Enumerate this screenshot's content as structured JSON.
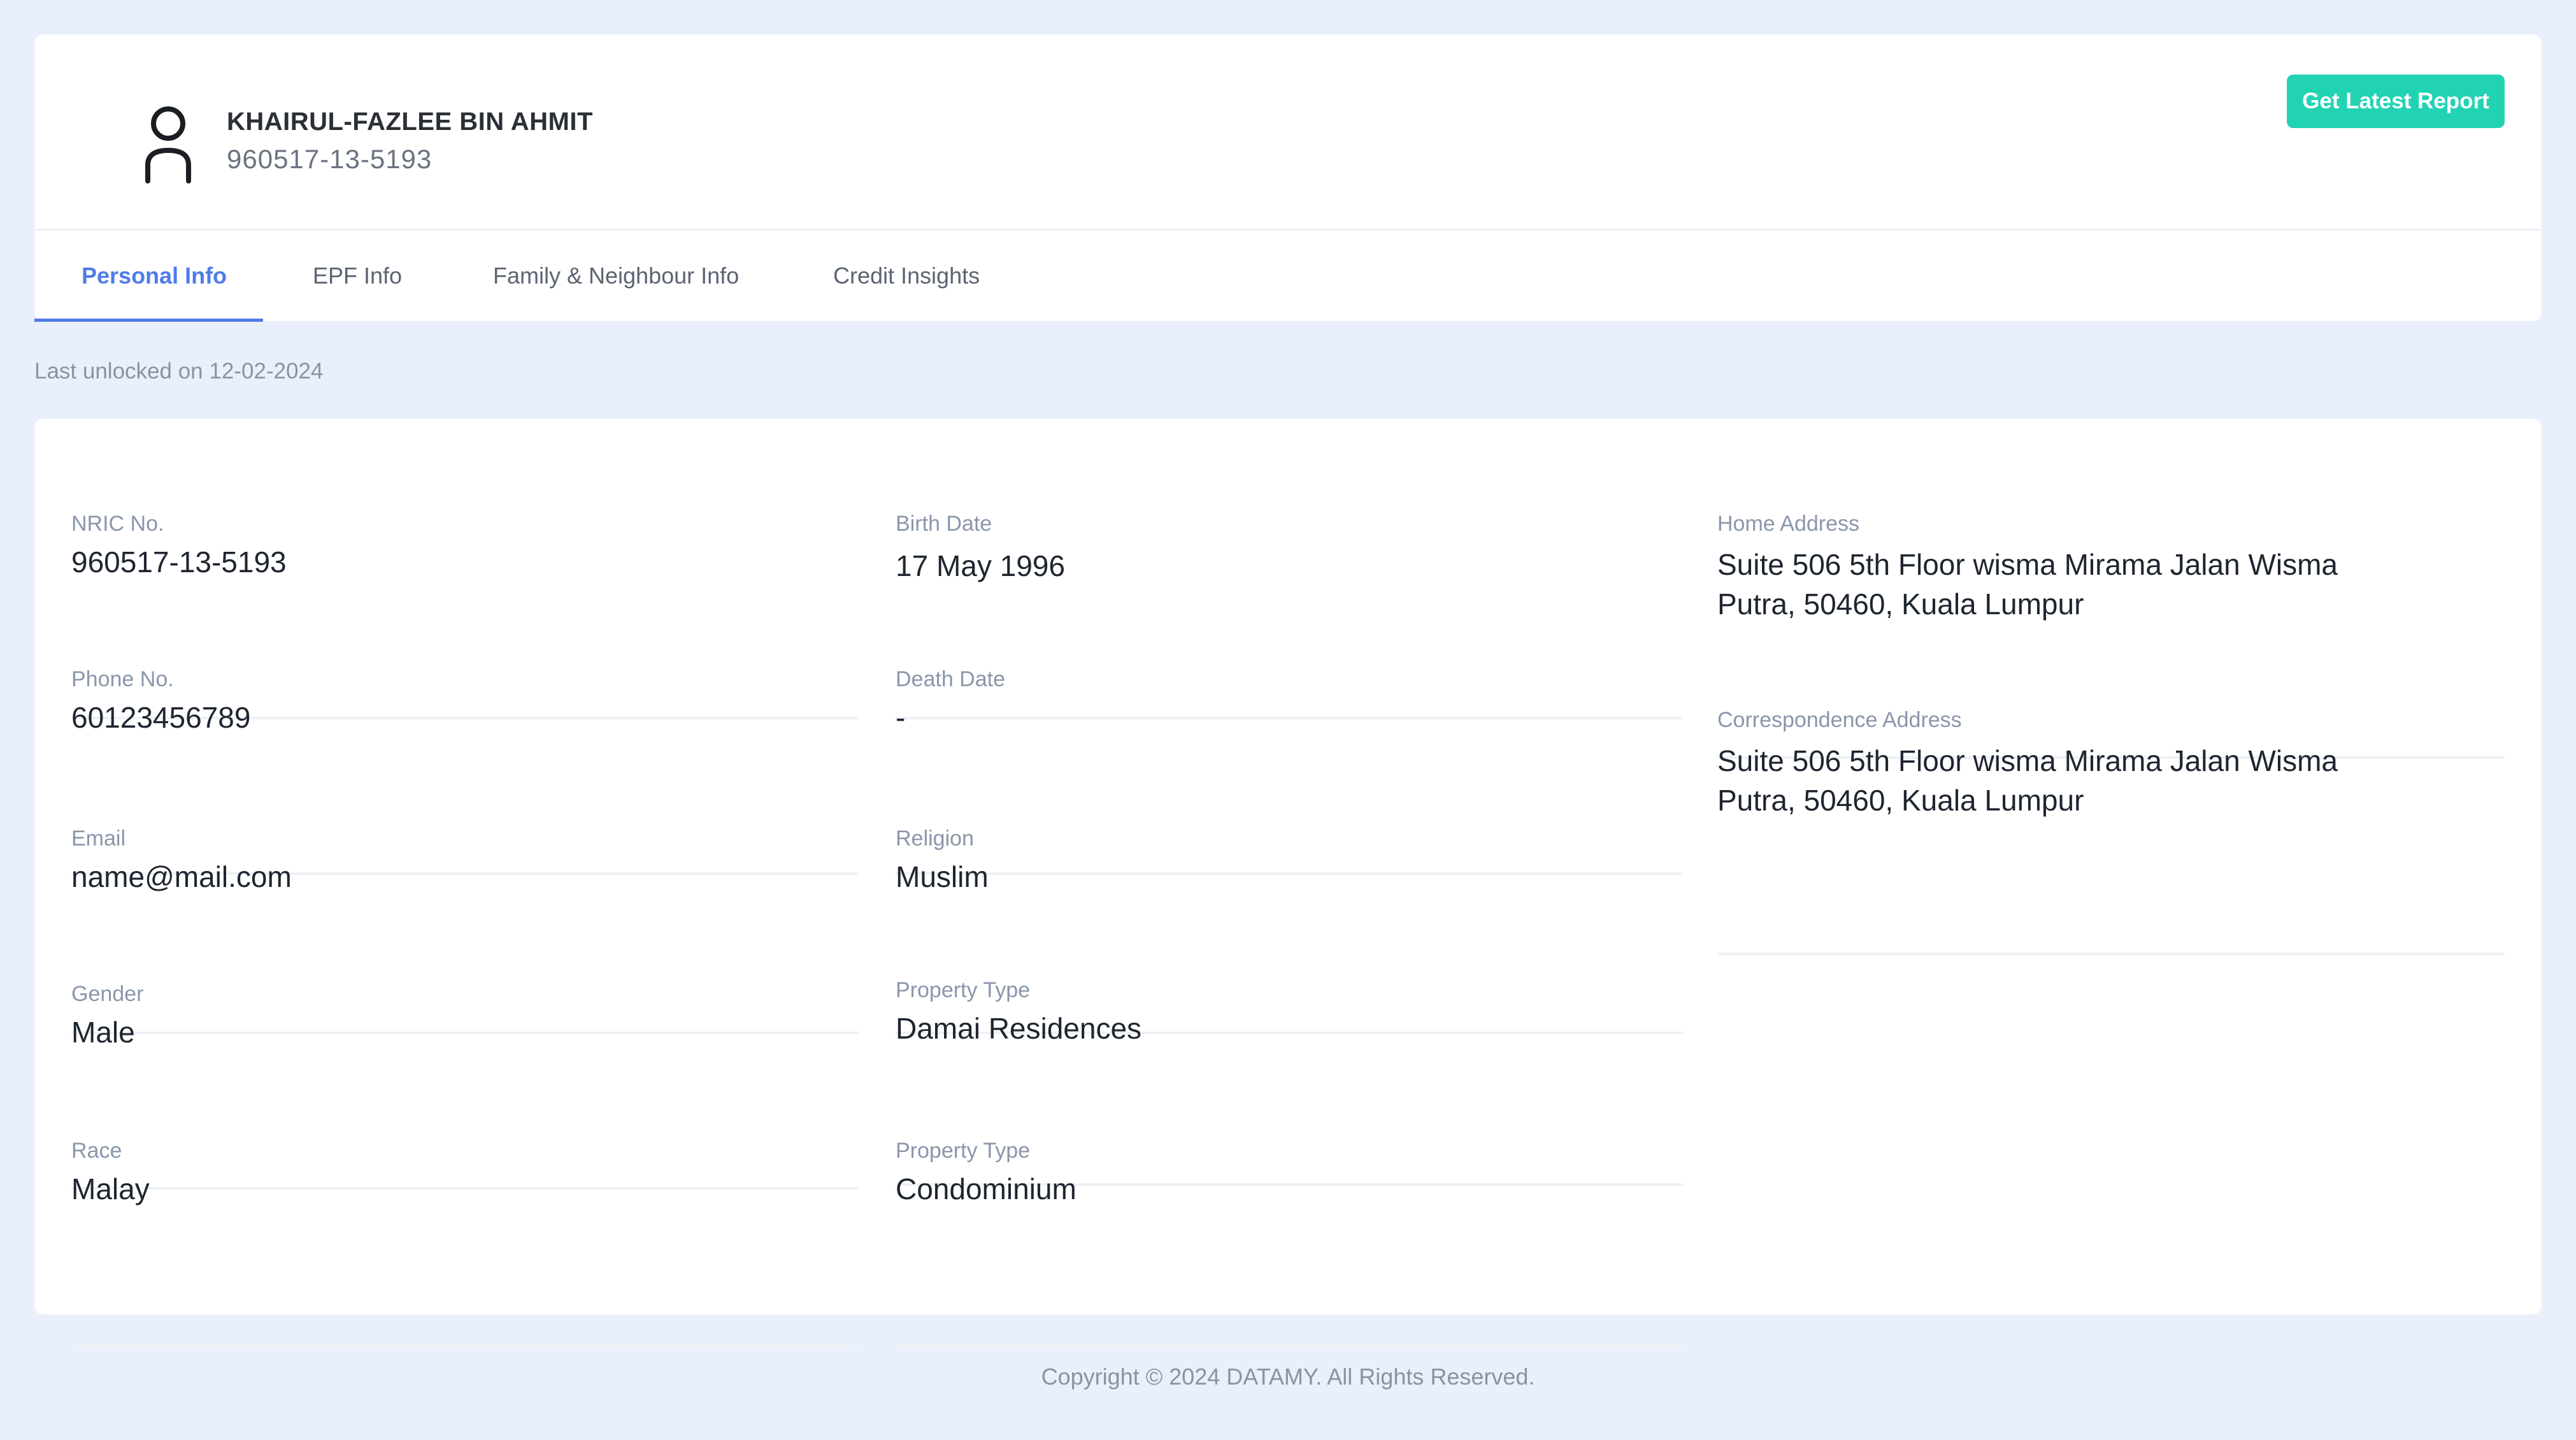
{
  "profile": {
    "name": "KHAIRUL-FAZLEE BIN AHMIT",
    "nric": "960517-13-5193",
    "report_button": "Get Latest Report"
  },
  "tabs": [
    {
      "label": "Personal Info",
      "active": true
    },
    {
      "label": "EPF Info",
      "active": false
    },
    {
      "label": "Family & Neighbour Info",
      "active": false
    },
    {
      "label": "Credit Insights",
      "active": false
    }
  ],
  "last_unlocked": "Last unlocked on 12-02-2024",
  "fields": {
    "col1": [
      {
        "label": "NRIC No.",
        "value": "960517-13-5193"
      },
      {
        "label": "Phone No.",
        "value": "60123456789"
      },
      {
        "label": "Email",
        "value": "name@mail.com"
      },
      {
        "label": "Gender",
        "value": "Male"
      },
      {
        "label": "Race",
        "value": "Malay"
      }
    ],
    "col2": [
      {
        "label": "Birth Date",
        "value": "17 May 1996"
      },
      {
        "label": "Death Date",
        "value": "-"
      },
      {
        "label": "Religion",
        "value": "Muslim"
      },
      {
        "label": "Property Type",
        "value": "Damai Residences"
      },
      {
        "label": "Property Type",
        "value": "Condominium"
      }
    ],
    "col3": [
      {
        "label": "Home Address",
        "value": "Suite 506 5th Floor wisma Mirama Jalan Wisma Putra, 50460, Kuala Lumpur"
      },
      {
        "label": "Correspondence Address",
        "value": "Suite 506 5th Floor wisma Mirama Jalan Wisma Putra, 50460, Kuala Lumpur"
      }
    ]
  },
  "footer": "Copyright © 2024 DATAMY. All Rights Reserved.",
  "colors": {
    "background": "#e9f0fb",
    "accent_tab": "#4f7bea",
    "button": "#21d3b3"
  },
  "icons": {
    "avatar": "user-outline-icon"
  }
}
